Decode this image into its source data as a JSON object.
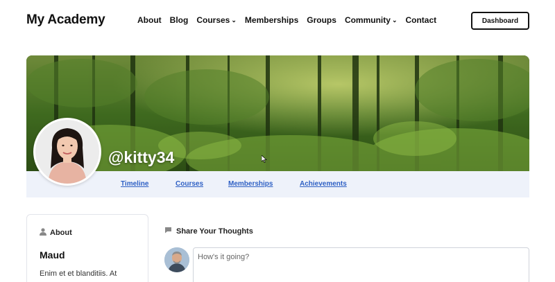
{
  "header": {
    "brand": "My Academy",
    "nav": [
      {
        "label": "About",
        "has_dropdown": false
      },
      {
        "label": "Blog",
        "has_dropdown": false
      },
      {
        "label": "Courses",
        "has_dropdown": true
      },
      {
        "label": "Memberships",
        "has_dropdown": false
      },
      {
        "label": "Groups",
        "has_dropdown": false
      },
      {
        "label": "Community",
        "has_dropdown": true
      },
      {
        "label": "Contact",
        "has_dropdown": false
      }
    ],
    "dashboard_label": "Dashboard"
  },
  "profile": {
    "username": "@kitty34",
    "tabs": [
      "Timeline",
      "Courses",
      "Memberships",
      "Achievements"
    ],
    "tab_color": "#2d5fc4"
  },
  "about": {
    "heading": "About",
    "name": "Maud",
    "bio": "Enim et et blanditiis. At"
  },
  "share": {
    "heading": "Share Your Thoughts",
    "placeholder": "How's it going?"
  },
  "icons": {
    "about": "user-icon",
    "share": "speech-bubble-icon",
    "dropdown": "chevron-down-icon"
  }
}
